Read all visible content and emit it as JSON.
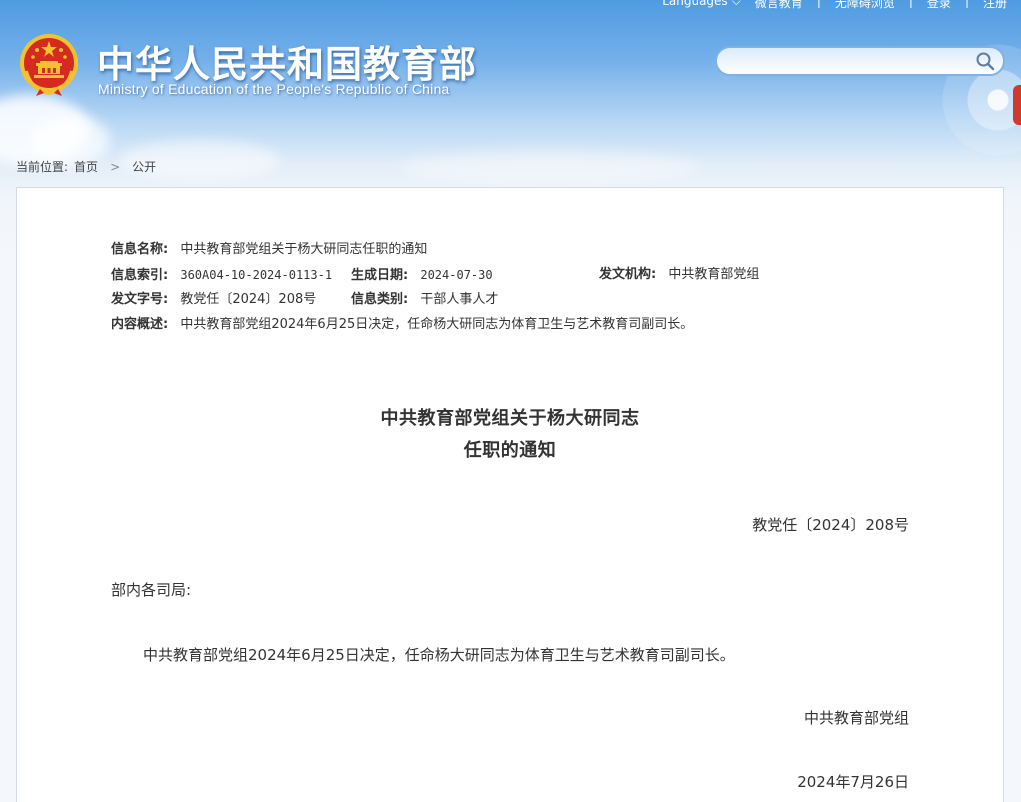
{
  "header": {
    "top_links": [
      "Languages",
      "微言教育",
      "无障碍浏览",
      "登录",
      "注册"
    ],
    "top_link_separator": "|",
    "title": "中华人民共和国教育部",
    "subtitle": "Ministry of Education of the People's Republic of China",
    "search": {
      "placeholder": "",
      "value": ""
    }
  },
  "breadcrumb": {
    "prefix": "当前位置:",
    "items": [
      "首页",
      "公开"
    ],
    "separator": ">"
  },
  "meta": {
    "name_label": "信息名称:",
    "name_value": "中共教育部党组关于杨大研同志任职的通知",
    "index_label": "信息索引:",
    "index_value": "360A04-10-2024-0113-1",
    "date_label": "生成日期:",
    "date_value": "2024-07-30",
    "org_label": "发文机构:",
    "org_value": "中共教育部党组",
    "docno_label": "发文字号:",
    "docno_value": "教党任〔2024〕208号",
    "category_label": "信息类别:",
    "category_value": "干部人事人才",
    "summary_label": "内容概述:",
    "summary_value": "中共教育部党组2024年6月25日决定，任命杨大研同志为体育卫生与艺术教育司副司长。"
  },
  "document": {
    "title_line1": "中共教育部党组关于杨大研同志",
    "title_line2": "任职的通知",
    "number": "教党任〔2024〕208号",
    "addressee": "部内各司局:",
    "body": "中共教育部党组2024年6月25日决定，任命杨大研同志为体育卫生与艺术教育司副司长。",
    "issuer": "中共教育部党组",
    "date": "2024年7月26日"
  },
  "colors": {
    "sky_top": "#4f9be2",
    "emblem_red": "#d42a20",
    "emblem_gold": "#f2c230",
    "search_border": "#7eb3e4",
    "text": "#333333"
  }
}
